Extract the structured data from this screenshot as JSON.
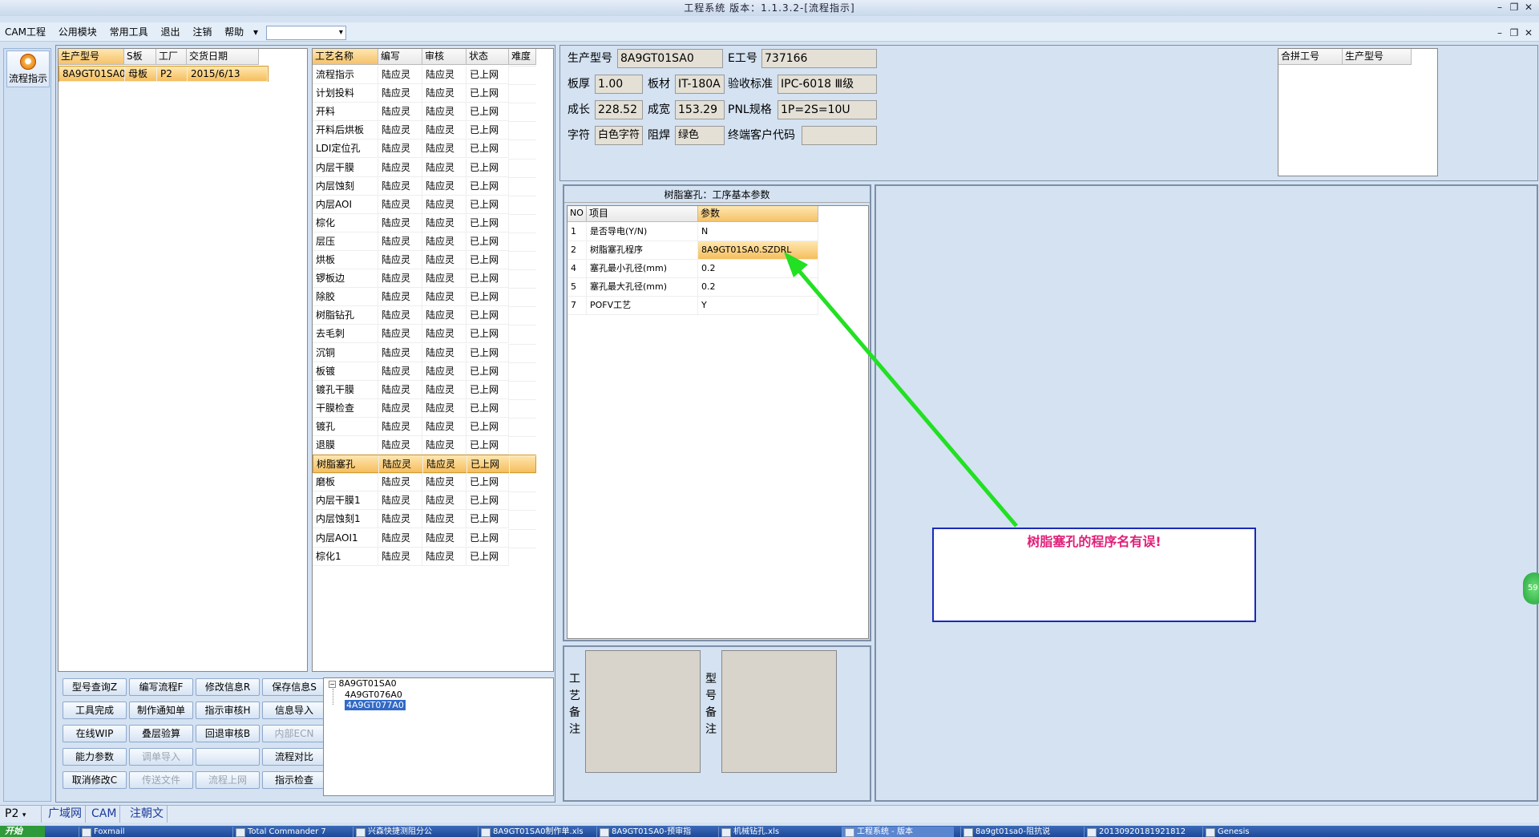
{
  "window": {
    "title": "工程系统 版本：1.1.3.2-[流程指示]"
  },
  "menu": {
    "items": [
      "CAM工程",
      "公用模块",
      "常用工具",
      "退出",
      "注销",
      "帮助"
    ],
    "combo_value": ""
  },
  "nav": {
    "button_label": "流程指示"
  },
  "model_list": {
    "columns": [
      "生产型号",
      "S板",
      "工厂",
      "交货日期"
    ],
    "rows": [
      [
        "8A9GT01SA0",
        "母板",
        "P2",
        "2015/6/13"
      ]
    ]
  },
  "process_list": {
    "columns": [
      "工艺名称",
      "编写",
      "审核",
      "状态",
      "难度"
    ],
    "rows": [
      [
        "流程指示",
        "陆应灵",
        "陆应灵",
        "已上网",
        ""
      ],
      [
        "计划投料",
        "陆应灵",
        "陆应灵",
        "已上网",
        ""
      ],
      [
        "开料",
        "陆应灵",
        "陆应灵",
        "已上网",
        ""
      ],
      [
        "开料后烘板",
        "陆应灵",
        "陆应灵",
        "已上网",
        ""
      ],
      [
        "LDI定位孔",
        "陆应灵",
        "陆应灵",
        "已上网",
        ""
      ],
      [
        "内层干膜",
        "陆应灵",
        "陆应灵",
        "已上网",
        ""
      ],
      [
        "内层蚀刻",
        "陆应灵",
        "陆应灵",
        "已上网",
        ""
      ],
      [
        "内层AOI",
        "陆应灵",
        "陆应灵",
        "已上网",
        ""
      ],
      [
        "棕化",
        "陆应灵",
        "陆应灵",
        "已上网",
        ""
      ],
      [
        "层压",
        "陆应灵",
        "陆应灵",
        "已上网",
        ""
      ],
      [
        "烘板",
        "陆应灵",
        "陆应灵",
        "已上网",
        ""
      ],
      [
        "锣板边",
        "陆应灵",
        "陆应灵",
        "已上网",
        ""
      ],
      [
        "除胶",
        "陆应灵",
        "陆应灵",
        "已上网",
        ""
      ],
      [
        "树脂钻孔",
        "陆应灵",
        "陆应灵",
        "已上网",
        ""
      ],
      [
        "去毛刺",
        "陆应灵",
        "陆应灵",
        "已上网",
        ""
      ],
      [
        "沉铜",
        "陆应灵",
        "陆应灵",
        "已上网",
        ""
      ],
      [
        "板镀",
        "陆应灵",
        "陆应灵",
        "已上网",
        ""
      ],
      [
        "镀孔干膜",
        "陆应灵",
        "陆应灵",
        "已上网",
        ""
      ],
      [
        "干膜检查",
        "陆应灵",
        "陆应灵",
        "已上网",
        ""
      ],
      [
        "镀孔",
        "陆应灵",
        "陆应灵",
        "已上网",
        ""
      ],
      [
        "退膜",
        "陆应灵",
        "陆应灵",
        "已上网",
        ""
      ],
      [
        "树脂塞孔",
        "陆应灵",
        "陆应灵",
        "已上网",
        ""
      ],
      [
        "磨板",
        "陆应灵",
        "陆应灵",
        "已上网",
        ""
      ],
      [
        "内层干膜1",
        "陆应灵",
        "陆应灵",
        "已上网",
        ""
      ],
      [
        "内层蚀刻1",
        "陆应灵",
        "陆应灵",
        "已上网",
        ""
      ],
      [
        "内层AOI1",
        "陆应灵",
        "陆应灵",
        "已上网",
        ""
      ],
      [
        "棕化1",
        "陆应灵",
        "陆应灵",
        "已上网",
        ""
      ]
    ],
    "selected_index": 21
  },
  "info": {
    "model_label": "生产型号",
    "model": "8A9GT01SA0",
    "e_label": "E工号",
    "e_no": "737166",
    "thick_label": "板厚",
    "thick": "1.00",
    "mat_label": "板材",
    "mat": "IT-180A",
    "std_label": "验收标准",
    "std": "IPC-6018 Ⅲ级",
    "len_label": "成长",
    "len": "228.52",
    "wid_label": "成宽",
    "wid": "153.29",
    "pnl_label": "PNL规格",
    "pnl": "1P=2S=10U",
    "char_label": "字符",
    "char": "白色字符",
    "mask_label": "阻焊",
    "mask": "绿色",
    "cust_label": "终端客户代码",
    "cust": ""
  },
  "merge_grid": {
    "columns": [
      "合拼工号",
      "生产型号"
    ]
  },
  "params": {
    "title": "树脂塞孔：工序基本参数",
    "columns": [
      "NO",
      "项目",
      "参数"
    ],
    "rows": [
      [
        "1",
        "是否导电(Y/N)",
        "N"
      ],
      [
        "2",
        "树脂塞孔程序",
        "8A9GT01SA0.SZDRL"
      ],
      [
        "4",
        "塞孔最小孔径(mm)",
        "0.2"
      ],
      [
        "5",
        "塞孔最大孔径(mm)",
        "0.2"
      ],
      [
        "7",
        "POFV工艺",
        "Y"
      ]
    ]
  },
  "memo": {
    "process_label": "工艺备注",
    "model_label": "型号备注",
    "process_text": "",
    "model_text": ""
  },
  "annotation": {
    "text": "树脂塞孔的程序名有误!",
    "color": "#e0207a"
  },
  "buttons": [
    [
      "型号查询Z",
      "编写流程F",
      "修改信息R",
      "保存信息S"
    ],
    [
      "工具完成",
      "制作通知单",
      "指示审核H",
      "信息导入"
    ],
    [
      "在线WIP",
      "叠层验算",
      "回退审核B",
      "内部ECN"
    ],
    [
      "能力参数",
      "调单导入",
      "",
      "流程对比"
    ],
    [
      "取消修改C",
      "传送文件",
      "流程上网",
      "指示检查"
    ]
  ],
  "disabled_buttons": [
    "内部ECN",
    "调单导入",
    "传送文件",
    "流程上网"
  ],
  "tree": {
    "root": "8A9GT01SA0",
    "children": [
      "4A9GT076A0",
      "4A9GT077A0"
    ],
    "selected": "4A9GT077A0"
  },
  "statusbar": {
    "items": [
      "P2",
      "广域网",
      "CAM",
      "注朝文"
    ]
  },
  "taskbar": {
    "start": "开始",
    "items": [
      "Foxmail",
      "Total Commander 7",
      "兴森快捷测阻分公",
      "8A9GT01SA0制作单.xls",
      "8A9GT01SA0-预审指",
      "机械钻孔.xls",
      "工程系统 - 版本",
      "8a9gt01sa0-阻抗说",
      "20130920181921812",
      "Genesis"
    ]
  },
  "side_badge": "59"
}
